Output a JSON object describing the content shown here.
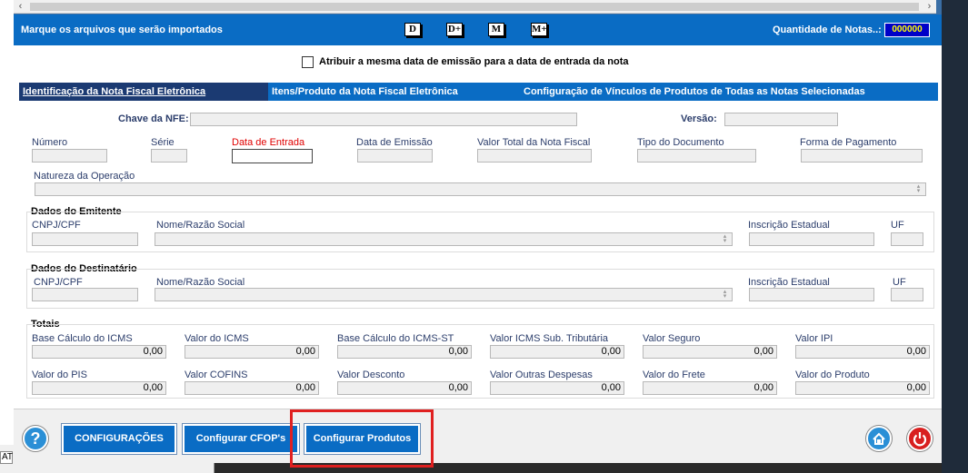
{
  "header": {
    "title": "Marque os arquivos que serão importados",
    "mark_buttons": [
      "D",
      "D+",
      "M",
      "M+"
    ],
    "qty_label": "Quantidade de Notas..:",
    "qty_value": "000000"
  },
  "options": {
    "same_date_label": "Atribuir a mesma data de emissão para a data de entrada da nota"
  },
  "tabs": [
    "Identificação da Nota Fiscal Eletrônica",
    "Itens/Produto da Nota Fiscal Eletrônica",
    "Configuração de Vínculos de Produtos de Todas as Notas Selecionadas"
  ],
  "nfe": {
    "chave_label": "Chave da NFE:",
    "versao_label": "Versão:",
    "numero_label": "Número",
    "serie_label": "Série",
    "data_entrada_label": "Data de Entrada",
    "data_emissao_label": "Data de Emissão",
    "valor_total_label": "Valor Total da Nota Fiscal",
    "tipo_doc_label": "Tipo do Documento",
    "forma_pag_label": "Forma de Pagamento",
    "natureza_label": "Natureza da Operação"
  },
  "emitente": {
    "title": "Dados do Emitente",
    "cnpj_label": "CNPJ/CPF",
    "nome_label": "Nome/Razão Social",
    "ie_label": "Inscrição Estadual",
    "uf_label": "UF"
  },
  "destinatario": {
    "title": "Dados do Destinatário",
    "cnpj_label": "CNPJ/CPF",
    "nome_label": "Nome/Razão Social",
    "ie_label": "Inscrição Estadual",
    "uf_label": "UF"
  },
  "totais": {
    "title": "Totais",
    "row1": [
      {
        "label": "Base Cálculo do ICMS",
        "value": "0,00"
      },
      {
        "label": "Valor do ICMS",
        "value": "0,00"
      },
      {
        "label": "Base Cálculo do ICMS-ST",
        "value": "0,00"
      },
      {
        "label": "Valor ICMS Sub. Tributária",
        "value": "0,00"
      },
      {
        "label": "Valor Seguro",
        "value": "0,00"
      },
      {
        "label": "Valor IPI",
        "value": "0,00"
      }
    ],
    "row2": [
      {
        "label": "Valor do PIS",
        "value": "0,00"
      },
      {
        "label": "Valor COFINS",
        "value": "0,00"
      },
      {
        "label": "Valor Desconto",
        "value": "0,00"
      },
      {
        "label": "Valor Outras Despesas",
        "value": "0,00"
      },
      {
        "label": "Valor do Frete",
        "value": "0,00"
      },
      {
        "label": "Valor do Produto",
        "value": "0,00"
      }
    ]
  },
  "toolbar": {
    "help_label": "?",
    "config_label": "CONFIGURAÇÕES",
    "cfop_label": "Configurar CFOP's",
    "produtos_label": "Configurar Produtos"
  },
  "left_stub_label": "AT",
  "colors": {
    "brand_blue": "#0a6cc4",
    "active_tab": "#1b3a72",
    "qty_bg": "#0000c8",
    "qty_text": "#ffff00",
    "highlight": "#e02020",
    "required_label": "#e00000"
  }
}
